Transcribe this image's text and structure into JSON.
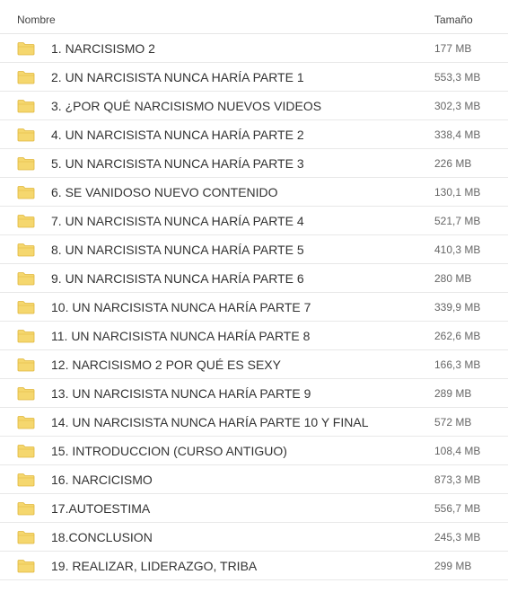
{
  "header": {
    "name_label": "Nombre",
    "size_label": "Tamaño"
  },
  "colors": {
    "folder_fill": "#f5d76e",
    "folder_stroke": "#e0b73c"
  },
  "files": [
    {
      "icon": "folder-icon",
      "name": "1. NARCISISMO 2",
      "size": "177 MB"
    },
    {
      "icon": "folder-icon",
      "name": "2. UN NARCISISTA NUNCA HARÍA PARTE 1",
      "size": "553,3 MB"
    },
    {
      "icon": "folder-icon",
      "name": "3. ¿POR QUÉ NARCISISMO NUEVOS VIDEOS",
      "size": "302,3 MB"
    },
    {
      "icon": "folder-icon",
      "name": "4. UN NARCISISTA NUNCA HARÍA PARTE 2",
      "size": "338,4 MB"
    },
    {
      "icon": "folder-icon",
      "name": "5. UN NARCISISTA NUNCA HARÍA PARTE 3",
      "size": "226 MB"
    },
    {
      "icon": "folder-icon",
      "name": "6. SE VANIDOSO NUEVO CONTENIDO",
      "size": "130,1 MB"
    },
    {
      "icon": "folder-icon",
      "name": "7. UN NARCISISTA NUNCA HARÍA PARTE 4",
      "size": "521,7 MB"
    },
    {
      "icon": "folder-icon",
      "name": "8. UN NARCISISTA NUNCA HARÍA PARTE 5",
      "size": "410,3 MB"
    },
    {
      "icon": "folder-icon",
      "name": "9. UN NARCISISTA NUNCA HARÍA PARTE 6",
      "size": "280 MB"
    },
    {
      "icon": "folder-icon",
      "name": "10. UN NARCISISTA NUNCA HARÍA PARTE 7",
      "size": "339,9 MB"
    },
    {
      "icon": "folder-icon",
      "name": "11. UN NARCISISTA NUNCA HARÍA PARTE 8",
      "size": "262,6 MB"
    },
    {
      "icon": "folder-icon",
      "name": "12. NARCISISMO 2 POR QUÉ ES SEXY",
      "size": "166,3 MB"
    },
    {
      "icon": "folder-icon",
      "name": "13. UN NARCISISTA NUNCA HARÍA PARTE 9",
      "size": "289 MB"
    },
    {
      "icon": "folder-icon",
      "name": "14. UN NARCISISTA NUNCA HARÍA PARTE 10 Y FINAL",
      "size": "572 MB"
    },
    {
      "icon": "folder-icon",
      "name": "15. INTRODUCCION (CURSO ANTIGUO)",
      "size": "108,4 MB"
    },
    {
      "icon": "folder-icon",
      "name": "16. NARCICISMO",
      "size": "873,3 MB"
    },
    {
      "icon": "folder-icon",
      "name": "17.AUTOESTIMA",
      "size": "556,7 MB"
    },
    {
      "icon": "folder-icon",
      "name": "18.CONCLUSION",
      "size": "245,3 MB"
    },
    {
      "icon": "folder-icon",
      "name": "19. REALIZAR, LIDERAZGO, TRIBA",
      "size": "299 MB"
    }
  ]
}
